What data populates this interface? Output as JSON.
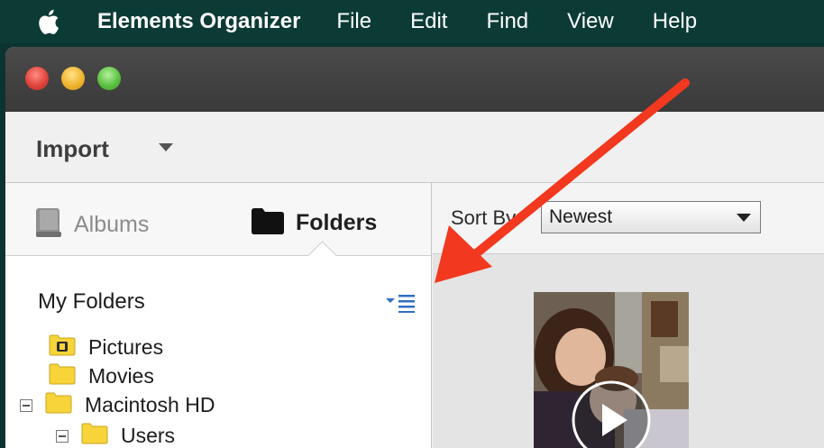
{
  "menubar": {
    "app_name": "Elements Organizer",
    "items": [
      "File",
      "Edit",
      "Find",
      "View",
      "Help"
    ]
  },
  "toolbar": {
    "import_label": "Import"
  },
  "tabs": {
    "albums": "Albums",
    "folders": "Folders"
  },
  "sidebar": {
    "heading": "My Folders",
    "tree": [
      {
        "label": "Pictures",
        "icon": "pictures-folder-icon"
      },
      {
        "label": "Movies",
        "icon": "folder-icon"
      },
      {
        "label": "Macintosh HD",
        "icon": "folder-icon",
        "expanded": true
      },
      {
        "label": "Users",
        "icon": "folder-icon",
        "expanded": true
      }
    ]
  },
  "sort": {
    "label": "Sort By:",
    "value": "Newest"
  },
  "colors": {
    "menubar_bg": "#0c3b36",
    "folder_yellow": "#f7d43a",
    "accent_blue": "#2f6fc1",
    "annotation_red": "#f2381f"
  }
}
